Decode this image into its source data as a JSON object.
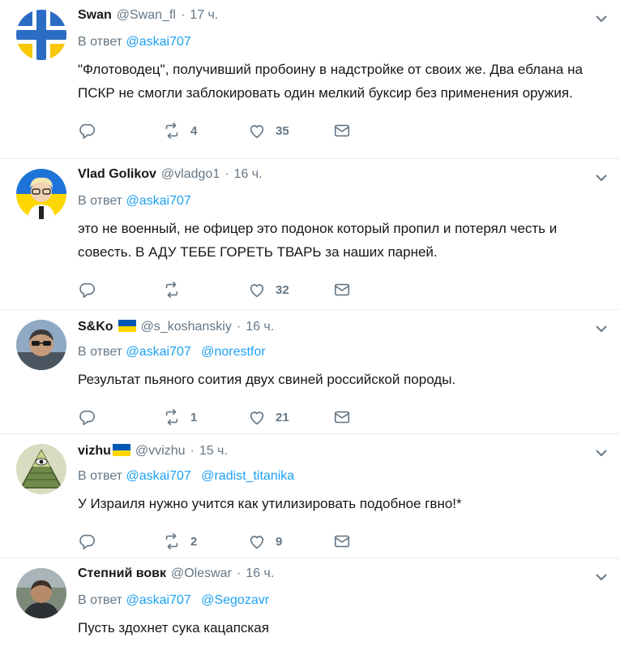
{
  "reply_prefix": "В ответ",
  "tweets": [
    {
      "name": "Swan",
      "handle": "@Swan_fl",
      "dot": "·",
      "time": "17 ч.",
      "mentions": [
        "@askai707"
      ],
      "text": "\"Флотоводец\", получивший пробоину в надстройке от своих же. Два еблана на ПСКР не смогли заблокировать один мелкий  буксир без применения оружия.",
      "retweets": "4",
      "likes": "35",
      "flag": false,
      "avatar": "swedish-naval-cross"
    },
    {
      "name": "Vlad Golikov",
      "handle": "@vladgo1",
      "dot": "·",
      "time": "16 ч.",
      "mentions": [
        "@askai707"
      ],
      "text": "это не военный, не офицер это подонок который пропил и потерял честь и совесть. В АДУ ТЕБЕ ГОРЕТЬ ТВАРЬ за наших парней.",
      "retweets": "",
      "likes": "32",
      "flag": false,
      "avatar": "cartoon-man-ukraine-flag"
    },
    {
      "name": "S&Ko",
      "handle": "@s_koshanskiy",
      "dot": "·",
      "time": "16 ч.",
      "mentions": [
        "@askai707",
        "@norestfor"
      ],
      "text": "Результат пьяного соития двух свиней российской породы.",
      "retweets": "1",
      "likes": "21",
      "flag": true,
      "avatar": "man-with-sunglasses"
    },
    {
      "name": "vizhu",
      "handle": "@vvizhu",
      "dot": "·",
      "time": "15 ч.",
      "mentions": [
        "@askai707",
        "@radist_titanika"
      ],
      "text": "У Израиля нужно учится как утилизировать подобное гвно!*",
      "retweets": "2",
      "likes": "9",
      "flag": true,
      "avatar": "all-seeing-eye-pyramid"
    },
    {
      "name": "Степний вовк",
      "handle": "@Oleswar",
      "dot": "·",
      "time": "16 ч.",
      "mentions": [
        "@askai707",
        "@Segozavr"
      ],
      "text": "Пусть здохнет сука кацапская",
      "retweets": "",
      "likes": "",
      "flag": false,
      "avatar": "man-outdoors"
    }
  ],
  "colors": {
    "link": "#1da1f2",
    "muted": "#657786",
    "text": "#14171a",
    "border": "#e6ecf0",
    "flag_blue": "#0057b7",
    "flag_yellow": "#ffd700"
  }
}
